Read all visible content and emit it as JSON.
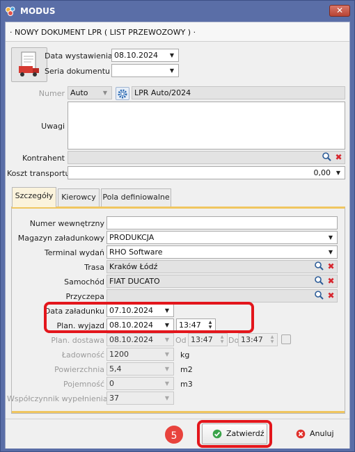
{
  "window": {
    "title": "MODUS",
    "close_glyph": "✕"
  },
  "header": {
    "text": "· NOWY DOKUMENT LPR ( LIST PRZEWOZOWY ) ·"
  },
  "doc": {
    "date_issued_label": "Data wystawienia",
    "date_issued_value": "08.10.2024",
    "series_label": "Seria dokumentu",
    "series_value": "",
    "number_label": "Numer",
    "number_mode": "Auto",
    "number_value": "LPR Auto/2024",
    "notes_label": "Uwagi",
    "notes_value": "",
    "contractor_label": "Kontrahent",
    "contractor_value": "",
    "transport_cost_label": "Koszt transportu",
    "transport_cost_value": "0,00"
  },
  "tabs": [
    {
      "label": "Szczegóły",
      "active": true
    },
    {
      "label": "Kierowcy",
      "active": false
    },
    {
      "label": "Pola definiowalne",
      "active": false
    }
  ],
  "details": {
    "internal_number_label": "Numer wewnętrzny",
    "internal_number_value": "",
    "warehouse_label": "Magazyn załadunkowy",
    "warehouse_value": "PRODUKCJA",
    "terminal_label": "Terminal wydań",
    "terminal_value": "RHO Software",
    "route_label": "Trasa",
    "route_value": "Kraków Łódź",
    "vehicle_label": "Samochód",
    "vehicle_value": "FIAT DUCATO",
    "trailer_label": "Przyczepa",
    "trailer_value": "",
    "loading_date_label": "Data załadunku",
    "loading_date_value": "07.10.2024",
    "planned_departure_label": "Plan. wyjazd",
    "planned_departure_date": "08.10.2024",
    "planned_departure_time": "13:47",
    "planned_delivery_label": "Plan. dostawa",
    "planned_delivery_date": "08.10.2024",
    "from_label": "Od",
    "from_value": "13:47",
    "to_label": "Do",
    "to_value": "13:47",
    "capacity_label": "Ładowność",
    "capacity_value": "1200",
    "capacity_unit": "kg",
    "area_label": "Powierzchnia",
    "area_value": "5,4",
    "area_unit": "m2",
    "volume_label": "Pojemność",
    "volume_value": "0",
    "volume_unit": "m3",
    "fill_factor_label": "Współczynnik wypełnienia",
    "fill_factor_value": "37"
  },
  "footer": {
    "step_badge": "5",
    "confirm_label": "Zatwierdź",
    "cancel_label": "Anuluj"
  },
  "colors": {
    "accent_tab": "#f0c660",
    "highlight_red": "#e3161c",
    "window_frame": "#5a6ea7"
  },
  "icons": [
    "modus-app-icon",
    "document-truck-icon",
    "gear-icon",
    "search-icon",
    "delete-x-icon",
    "check-icon",
    "cancel-icon"
  ]
}
